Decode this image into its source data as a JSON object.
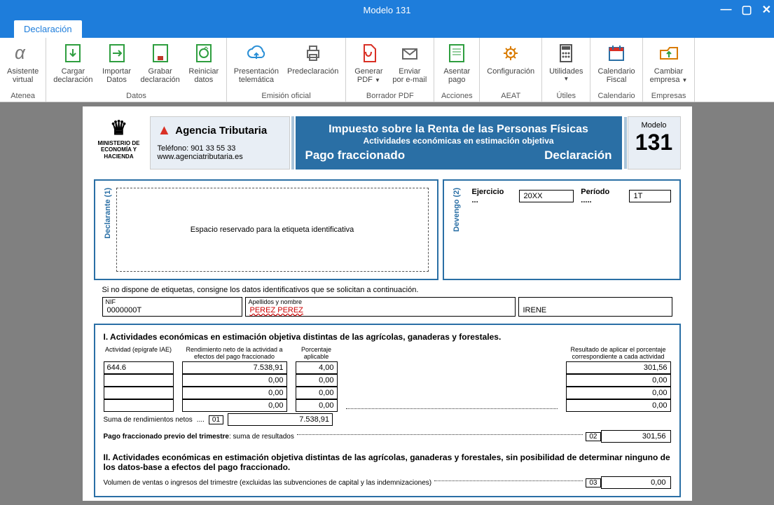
{
  "window": {
    "title": "Modelo 131"
  },
  "tabs": {
    "declaration": "Declaración"
  },
  "ribbon": {
    "groups": [
      {
        "label": "Atenea",
        "buttons": [
          {
            "id": "asistente",
            "line1": "Asistente",
            "line2": "virtual",
            "iconColor": "#888"
          }
        ]
      },
      {
        "label": "Datos",
        "buttons": [
          {
            "id": "cargar",
            "line1": "Cargar",
            "line2": "declaración",
            "iconColor": "#2E9E3F"
          },
          {
            "id": "importar",
            "line1": "Importar",
            "line2": "Datos",
            "iconColor": "#2E9E3F"
          },
          {
            "id": "grabar",
            "line1": "Grabar",
            "line2": "declaración",
            "iconColor": "#2E9E3F"
          },
          {
            "id": "reiniciar",
            "line1": "Reiniciar",
            "line2": "datos",
            "iconColor": "#2E9E3F"
          }
        ]
      },
      {
        "label": "Emisión oficial",
        "buttons": [
          {
            "id": "presentacion",
            "line1": "Presentación",
            "line2": "telemática",
            "iconColor": "#2A8FD6"
          },
          {
            "id": "predeclaracion",
            "line1": "Predeclaración",
            "line2": "",
            "iconColor": "#666"
          }
        ]
      },
      {
        "label": "Borrador PDF",
        "buttons": [
          {
            "id": "generarpdf",
            "line1": "Generar",
            "line2": "PDF",
            "dropdown": true,
            "iconColor": "#D93025"
          },
          {
            "id": "enviarmail",
            "line1": "Enviar",
            "line2": "por e-mail",
            "iconColor": "#666"
          }
        ]
      },
      {
        "label": "Acciones",
        "buttons": [
          {
            "id": "asentar",
            "line1": "Asentar",
            "line2": "pago",
            "iconColor": "#2E9E3F"
          }
        ]
      },
      {
        "label": "AEAT",
        "buttons": [
          {
            "id": "config",
            "line1": "Configuración",
            "line2": "",
            "iconColor": "#D97B00"
          }
        ]
      },
      {
        "label": "Útiles",
        "buttons": [
          {
            "id": "utilidades",
            "line1": "Utilidades",
            "line2": "",
            "dropdown": true,
            "iconColor": "#555"
          }
        ]
      },
      {
        "label": "Calendario",
        "buttons": [
          {
            "id": "calfiscal",
            "line1": "Calendario",
            "line2": "Fiscal",
            "iconColor": "#D93025"
          }
        ]
      },
      {
        "label": "Empresas",
        "buttons": [
          {
            "id": "cambiar",
            "line1": "Cambiar",
            "line2": "empresa",
            "dropdown": true,
            "iconColor": "#D97B00"
          }
        ]
      }
    ]
  },
  "form": {
    "ministerio": "MINISTERIO DE ECONOMÍA Y HACIENDA",
    "agencia_name": "Agencia Tributaria",
    "agencia_phone_label": "Teléfono: 901 33 55 33",
    "agencia_web": "www.agenciatributaria.es",
    "blue_t1": "Impuesto sobre la Renta de las Personas Físicas",
    "blue_t2": "Actividades económicas en estimación objetiva",
    "blue_t3a": "Pago fraccionado",
    "blue_t3b": "Declaración",
    "model_label": "Modelo",
    "model_number": "131",
    "declarante_label": "Declarante (1)",
    "devengo_label": "Devengo (2)",
    "espacio_label": "Espacio reservado para la etiqueta identificativa",
    "ejercicio_label": "Ejercicio",
    "ejercicio_value": "20XX",
    "periodo_label": "Período",
    "periodo_value": "1T",
    "etiqueta_note": "Si no dispone de etiquetas, consigne los datos identificativos que se solicitan a continuación.",
    "nif_label": "NIF",
    "nif_value": "0000000T",
    "apell_label": "Apellidos y nombre",
    "apell_value": "PEREZ PEREZ",
    "nombre_value": "IRENE",
    "sectionI_title": "I.  Actividades económicas en estimación objetiva distintas de las agrícolas, ganaderas y forestales.",
    "hdr_actividad": "Actividad (epígrafe IAE)",
    "hdr_rendimiento": "Rendimiento neto de la actividad a efectos del pago fraccionado",
    "hdr_porcentaje": "Porcentaje aplicable",
    "hdr_resultado": "Resultado de aplicar el porcentaje correspondiente a cada actividad",
    "rows": [
      {
        "iae": "644.6",
        "rend": "7.538,91",
        "pct": "4,00",
        "res": "301,56"
      },
      {
        "iae": "",
        "rend": "0,00",
        "pct": "0,00",
        "res": "0,00"
      },
      {
        "iae": "",
        "rend": "0,00",
        "pct": "0,00",
        "res": "0,00"
      },
      {
        "iae": "",
        "rend": "0,00",
        "pct": "0,00",
        "res": "0,00"
      }
    ],
    "suma_label": "Suma de rendimientos netos",
    "suma_box": "01",
    "suma_val": "7.538,91",
    "pago_label": "Pago fraccionado previo del trimestre",
    "pago_suffix": ": suma de resultados",
    "pago_box": "02",
    "pago_val": "301,56",
    "sectionII_title": "II.  Actividades económicas en estimación objetiva distintas de las agrícolas, ganaderas y forestales, sin posibilidad de determinar ninguno de los datos-base a efectos del pago fraccionado.",
    "volumen_label": "Volumen de ventas o ingresos del trimestre (excluidas las subvenciones de capital y las indemnizaciones)",
    "volumen_box": "03",
    "volumen_val": "0,00"
  }
}
